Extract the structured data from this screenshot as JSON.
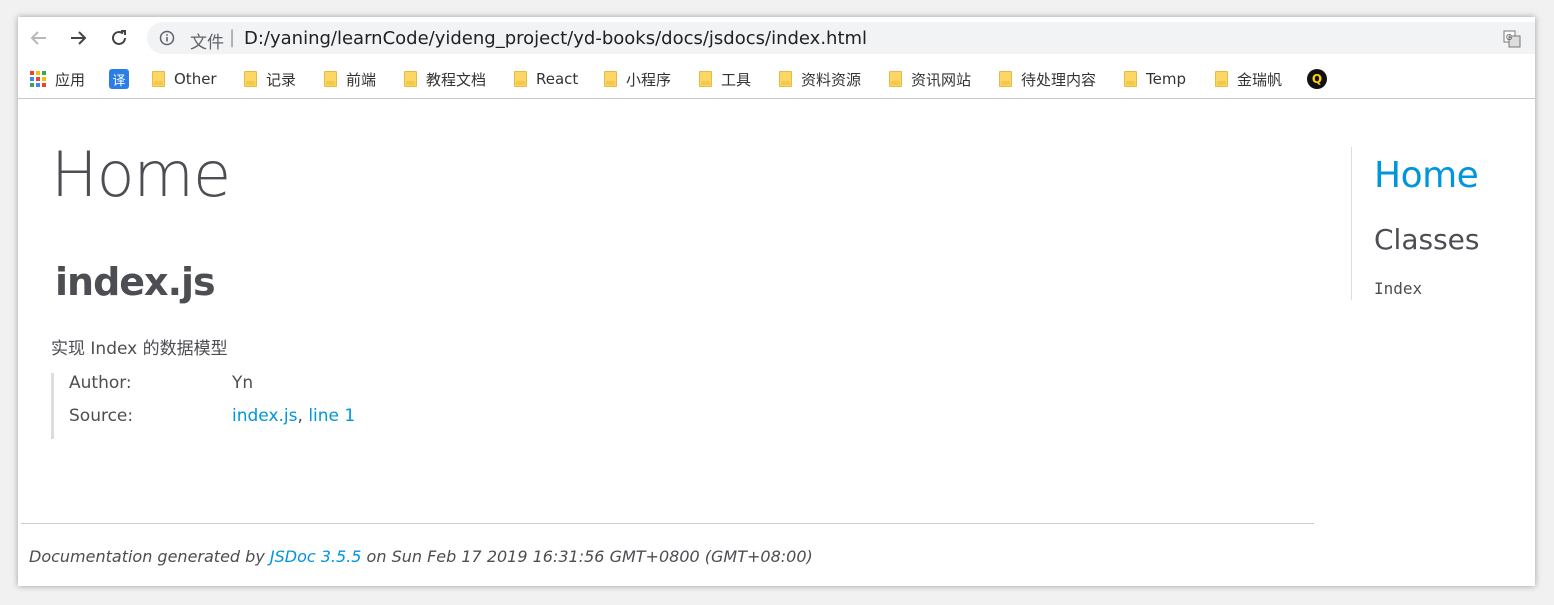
{
  "browser": {
    "scheme_label": "文件",
    "separator": "|",
    "url": "D:/yaning/learnCode/yideng_project/yd-books/docs/jsdocs/index.html"
  },
  "bookmarks": {
    "apps_label": "应用",
    "translate_badge": "译",
    "items": [
      "Other",
      "记录",
      "前端",
      "教程文档",
      "React",
      "小程序",
      "工具",
      "资料资源",
      "资讯网站",
      "待处理内容",
      "Temp",
      "金瑞帆"
    ],
    "q_badge": "Q"
  },
  "doc": {
    "title": "Home",
    "file_heading": "index.js",
    "description": "实现 Index 的数据模型",
    "details": {
      "author_label": "Author:",
      "author_value": "Yn",
      "source_label": "Source:",
      "source_file": "index.js",
      "source_comma": ",",
      "source_line": "line 1"
    },
    "footer": {
      "prefix": "Documentation generated by",
      "generator": "JSDoc 3.5.5",
      "suffix": "on Sun Feb 17 2019 16:31:56 GMT+0800 (GMT+08:00)"
    }
  },
  "sidebar": {
    "home": "Home",
    "section": "Classes",
    "items": [
      "Index"
    ]
  },
  "colors": {
    "link": "#0095dd",
    "text": "#4d4e53",
    "folder": "#fbd765"
  }
}
